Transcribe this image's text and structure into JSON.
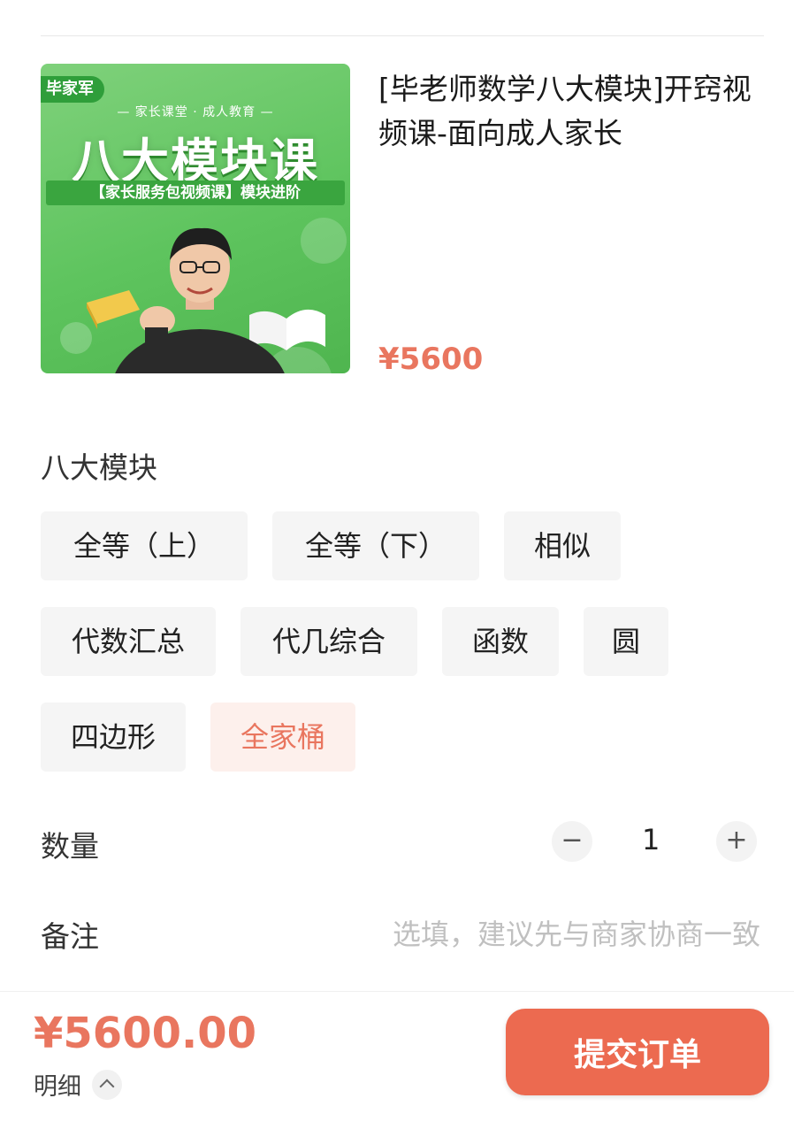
{
  "product": {
    "title": "[毕老师数学八大模块]开窍视频课-面向成人家长",
    "price": "¥5600",
    "thumbnail": {
      "brand": "毕家军",
      "subtitle": "— 家长课堂 · 成人教育 —",
      "headline": "八大模块课",
      "tag": "【家长服务包视频课】模块进阶",
      "background_color": "#5ec45e"
    }
  },
  "options": {
    "section_title": "八大模块",
    "items": [
      {
        "label": "全等（上）",
        "selected": false
      },
      {
        "label": "全等（下）",
        "selected": false
      },
      {
        "label": "相似",
        "selected": false
      },
      {
        "label": "代数汇总",
        "selected": false
      },
      {
        "label": "代几综合",
        "selected": false
      },
      {
        "label": "函数",
        "selected": false
      },
      {
        "label": "圆",
        "selected": false
      },
      {
        "label": "四边形",
        "selected": false
      },
      {
        "label": "全家桶",
        "selected": true
      }
    ]
  },
  "quantity": {
    "label": "数量",
    "value": "1",
    "minus": "−",
    "plus": "+"
  },
  "note": {
    "label": "备注",
    "placeholder": "选填，建议先与商家协商一致"
  },
  "footer": {
    "total": "¥5600.00",
    "detail_label": "明细",
    "submit_label": "提交订单"
  },
  "colors": {
    "accent": "#ec6a50",
    "price": "#e9765f",
    "selected_chip_bg": "#fdf0ec",
    "chip_bg": "#f5f5f5"
  }
}
